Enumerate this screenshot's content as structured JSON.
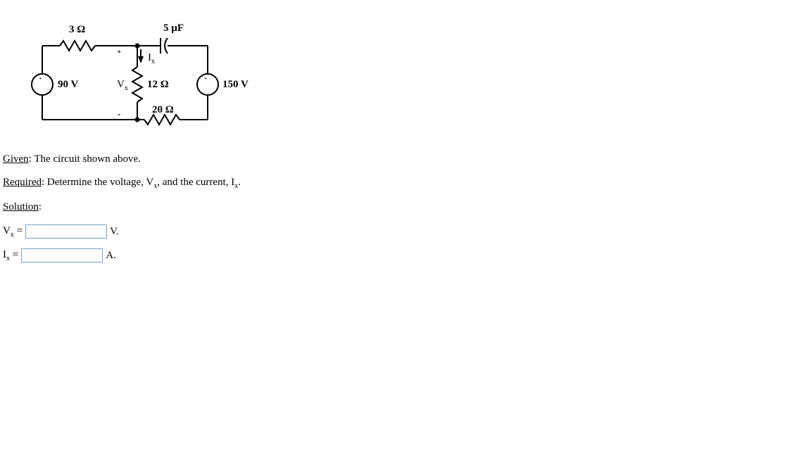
{
  "circuit": {
    "R1": "3 Ω",
    "C1": "5 µF",
    "Vs1": "90 V",
    "Vx": "V",
    "VxSub": "x",
    "Ix": "I",
    "IxSub": "x",
    "R2": "12 Ω",
    "Vs2": "150 V",
    "R3": "20 Ω",
    "plus": "+",
    "minus": "-"
  },
  "text": {
    "givenLabel": "Given",
    "given": ": The circuit shown above.",
    "requiredLabel": "Required",
    "required": ": Determine the voltage, V",
    "requiredSub1": "x",
    "requiredMid": ", and the current, I",
    "requiredSub2": "x",
    "requiredEnd": ".",
    "solutionLabel": "Solution",
    "solutionColon": ":",
    "VxVar": "V",
    "VxSub": "x",
    "eq": " =",
    "VxUnit": " V.",
    "IxVar": "I",
    "IxSub": "x",
    "IxUnit": " A."
  }
}
